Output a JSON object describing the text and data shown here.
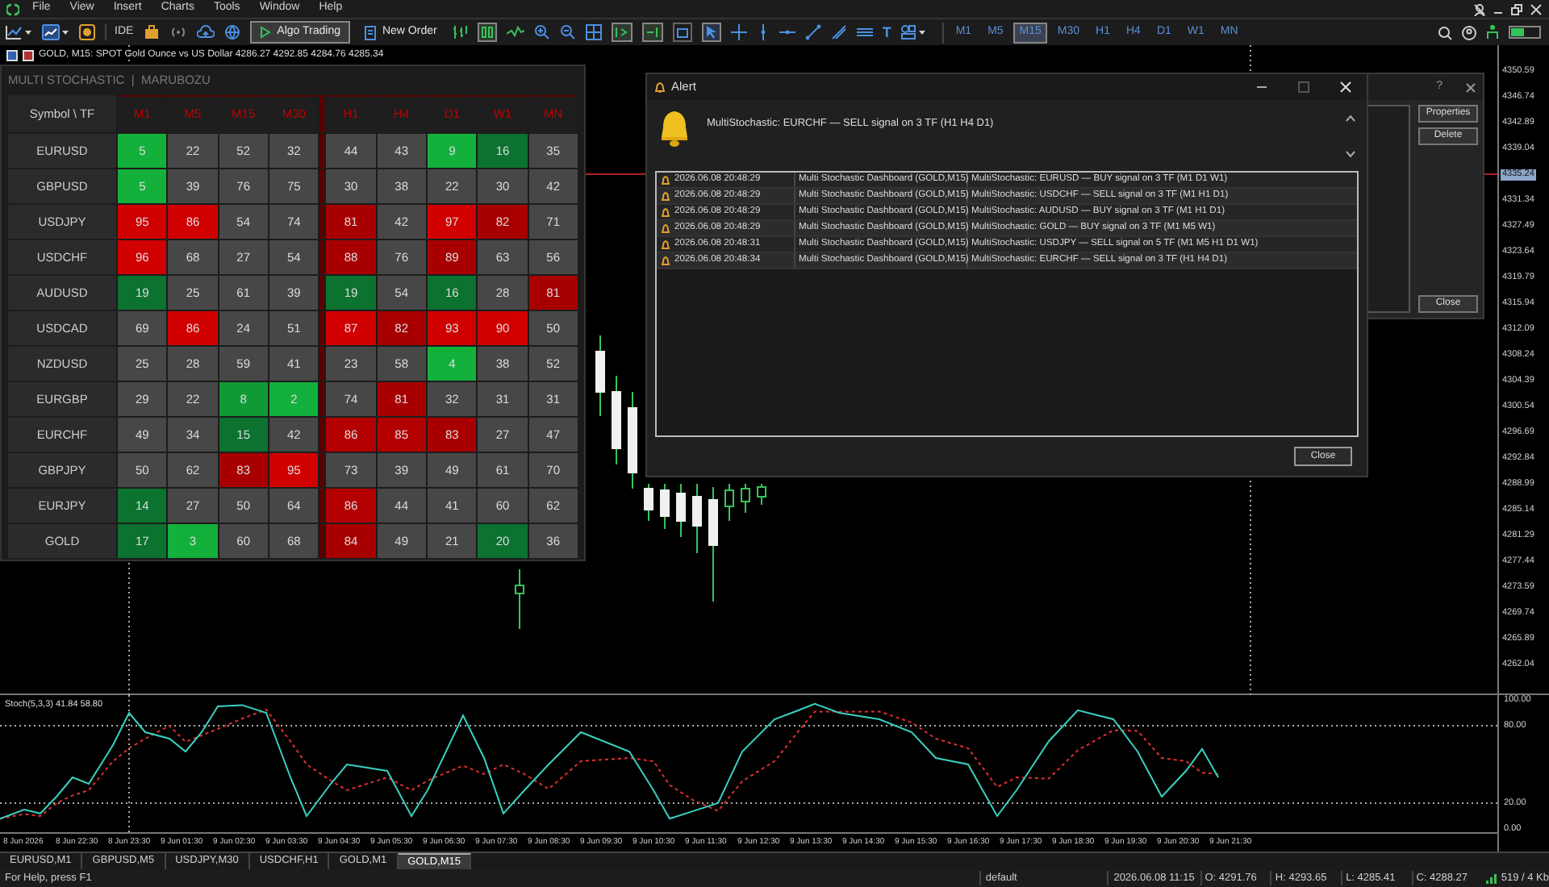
{
  "menu": [
    "File",
    "View",
    "Insert",
    "Charts",
    "Tools",
    "Window",
    "Help"
  ],
  "toolbar": {
    "ide_label": "IDE",
    "algo_trading": {
      "label": "Algo Trading",
      "on": true
    },
    "new_order": "New Order",
    "text_tool": "T",
    "timeframes": [
      {
        "label": "M1",
        "selected": false
      },
      {
        "label": "M5",
        "selected": false
      },
      {
        "label": "M15",
        "selected": true
      },
      {
        "label": "M30",
        "selected": false
      },
      {
        "label": "H1",
        "selected": false
      },
      {
        "label": "H4",
        "selected": false
      },
      {
        "label": "D1",
        "selected": false
      },
      {
        "label": "W1",
        "selected": false
      },
      {
        "label": "MN",
        "selected": false
      }
    ]
  },
  "chart": {
    "title": "GOLD, M15:  SPOT Gold Ounce vs US Dollar  4286.27 4292.85 4284.76 4285.34",
    "price_labels": [
      {
        "label": "4350.59",
        "current": false
      },
      {
        "label": "4346.74",
        "current": false
      },
      {
        "label": "4342.89",
        "current": false
      },
      {
        "label": "4339.04",
        "current": false
      },
      {
        "label": "4335.24",
        "current": true
      },
      {
        "label": "4331.34",
        "current": false
      },
      {
        "label": "4327.49",
        "current": false
      },
      {
        "label": "4323.64",
        "current": false
      },
      {
        "label": "4319.79",
        "current": false
      },
      {
        "label": "4315.94",
        "current": false
      },
      {
        "label": "4312.09",
        "current": false
      },
      {
        "label": "4308.24",
        "current": false
      },
      {
        "label": "4304.39",
        "current": false
      },
      {
        "label": "4300.54",
        "current": false
      },
      {
        "label": "4296.69",
        "current": false
      },
      {
        "label": "4292.84",
        "current": false
      },
      {
        "label": "4288.99",
        "current": false
      },
      {
        "label": "4285.14",
        "current": false
      },
      {
        "label": "4281.29",
        "current": false
      },
      {
        "label": "4277.44",
        "current": false
      },
      {
        "label": "4273.59",
        "current": false
      },
      {
        "label": "4269.74",
        "current": false
      },
      {
        "label": "4265.89",
        "current": false
      },
      {
        "label": "4262.04",
        "current": false
      }
    ],
    "time_labels": [
      "8 Jun 2026",
      "8 Jun 22:30",
      "8 Jun 23:30",
      "9 Jun 01:30",
      "9 Jun 02:30",
      "9 Jun 03:30",
      "9 Jun 04:30",
      "9 Jun 05:30",
      "9 Jun 06:30",
      "9 Jun 07:30",
      "9 Jun 08:30",
      "9 Jun 09:30",
      "9 Jun 10:30",
      "9 Jun 11:30",
      "9 Jun 12:30",
      "9 Jun 13:30",
      "9 Jun 14:30",
      "9 Jun 15:30",
      "9 Jun 16:30",
      "9 Jun 17:30",
      "9 Jun 18:30",
      "9 Jun 19:30",
      "9 Jun 20:30",
      "9 Jun 21:30"
    ]
  },
  "indicator": {
    "title": "Stoch(5,3,3) 41.84 58.80",
    "scale_labels": [
      "100.00",
      "80.00",
      "20.00",
      "0.00"
    ]
  },
  "dashboard": {
    "title": "MULTI STOCHASTIC  |  MARUBOZU",
    "corner": "Symbol \\ TF",
    "columns": [
      "M1",
      "M5",
      "M15",
      "M30",
      "H1",
      "H4",
      "D1",
      "W1",
      "MN"
    ],
    "rows": [
      {
        "symbol": "EURUSD",
        "cells": [
          {
            "value": "5",
            "color": "#14b03c"
          },
          {
            "value": "22",
            "color": "#474747"
          },
          {
            "value": "52",
            "color": "#474747"
          },
          {
            "value": "32",
            "color": "#474747"
          },
          {
            "value": "44",
            "color": "#474747"
          },
          {
            "value": "43",
            "color": "#474747"
          },
          {
            "value": "9",
            "color": "#14b03c"
          },
          {
            "value": "16",
            "color": "#0b7230"
          },
          {
            "value": "35",
            "color": "#474747"
          }
        ]
      },
      {
        "symbol": "GBPUSD",
        "cells": [
          {
            "value": "5",
            "color": "#14b03c"
          },
          {
            "value": "39",
            "color": "#474747"
          },
          {
            "value": "76",
            "color": "#474747"
          },
          {
            "value": "75",
            "color": "#474747"
          },
          {
            "value": "30",
            "color": "#474747"
          },
          {
            "value": "38",
            "color": "#474747"
          },
          {
            "value": "22",
            "color": "#474747"
          },
          {
            "value": "30",
            "color": "#474747"
          },
          {
            "value": "42",
            "color": "#474747"
          }
        ]
      },
      {
        "symbol": "USDJPY",
        "cells": [
          {
            "value": "95",
            "color": "#d10000"
          },
          {
            "value": "86",
            "color": "#d10000"
          },
          {
            "value": "54",
            "color": "#474747"
          },
          {
            "value": "74",
            "color": "#474747"
          },
          {
            "value": "81",
            "color": "#a80000"
          },
          {
            "value": "42",
            "color": "#474747"
          },
          {
            "value": "97",
            "color": "#d10000"
          },
          {
            "value": "82",
            "color": "#a80000"
          },
          {
            "value": "71",
            "color": "#474747"
          }
        ]
      },
      {
        "symbol": "USDCHF",
        "cells": [
          {
            "value": "96",
            "color": "#d10000"
          },
          {
            "value": "68",
            "color": "#474747"
          },
          {
            "value": "27",
            "color": "#474747"
          },
          {
            "value": "54",
            "color": "#474747"
          },
          {
            "value": "88",
            "color": "#a80000"
          },
          {
            "value": "76",
            "color": "#474747"
          },
          {
            "value": "89",
            "color": "#a80000"
          },
          {
            "value": "63",
            "color": "#474747"
          },
          {
            "value": "56",
            "color": "#474747"
          }
        ]
      },
      {
        "symbol": "AUDUSD",
        "cells": [
          {
            "value": "19",
            "color": "#0b7230"
          },
          {
            "value": "25",
            "color": "#474747"
          },
          {
            "value": "61",
            "color": "#474747"
          },
          {
            "value": "39",
            "color": "#474747"
          },
          {
            "value": "19",
            "color": "#0b7230"
          },
          {
            "value": "54",
            "color": "#474747"
          },
          {
            "value": "16",
            "color": "#0b7230"
          },
          {
            "value": "28",
            "color": "#474747"
          },
          {
            "value": "81",
            "color": "#a80000"
          }
        ]
      },
      {
        "symbol": "USDCAD",
        "cells": [
          {
            "value": "69",
            "color": "#474747"
          },
          {
            "value": "86",
            "color": "#d10000"
          },
          {
            "value": "24",
            "color": "#474747"
          },
          {
            "value": "51",
            "color": "#474747"
          },
          {
            "value": "87",
            "color": "#d10000"
          },
          {
            "value": "82",
            "color": "#a80000"
          },
          {
            "value": "93",
            "color": "#d10000"
          },
          {
            "value": "90",
            "color": "#d10000"
          },
          {
            "value": "50",
            "color": "#474747"
          }
        ]
      },
      {
        "symbol": "NZDUSD",
        "cells": [
          {
            "value": "25",
            "color": "#474747"
          },
          {
            "value": "28",
            "color": "#474747"
          },
          {
            "value": "59",
            "color": "#474747"
          },
          {
            "value": "41",
            "color": "#474747"
          },
          {
            "value": "23",
            "color": "#474747"
          },
          {
            "value": "58",
            "color": "#474747"
          },
          {
            "value": "4",
            "color": "#14b03c"
          },
          {
            "value": "38",
            "color": "#474747"
          },
          {
            "value": "52",
            "color": "#474747"
          }
        ]
      },
      {
        "symbol": "EURGBP",
        "cells": [
          {
            "value": "29",
            "color": "#474747"
          },
          {
            "value": "22",
            "color": "#474747"
          },
          {
            "value": "8",
            "color": "#109a36"
          },
          {
            "value": "2",
            "color": "#14b03c"
          },
          {
            "value": "74",
            "color": "#474747"
          },
          {
            "value": "81",
            "color": "#a80000"
          },
          {
            "value": "32",
            "color": "#474747"
          },
          {
            "value": "31",
            "color": "#474747"
          },
          {
            "value": "31",
            "color": "#474747"
          }
        ]
      },
      {
        "symbol": "EURCHF",
        "cells": [
          {
            "value": "49",
            "color": "#474747"
          },
          {
            "value": "34",
            "color": "#474747"
          },
          {
            "value": "15",
            "color": "#0b7230"
          },
          {
            "value": "42",
            "color": "#474747"
          },
          {
            "value": "86",
            "color": "#b30000"
          },
          {
            "value": "85",
            "color": "#b30000"
          },
          {
            "value": "83",
            "color": "#a80000"
          },
          {
            "value": "27",
            "color": "#474747"
          },
          {
            "value": "47",
            "color": "#474747"
          }
        ]
      },
      {
        "symbol": "GBPJPY",
        "cells": [
          {
            "value": "50",
            "color": "#474747"
          },
          {
            "value": "62",
            "color": "#474747"
          },
          {
            "value": "83",
            "color": "#a80000"
          },
          {
            "value": "95",
            "color": "#d10000"
          },
          {
            "value": "73",
            "color": "#474747"
          },
          {
            "value": "39",
            "color": "#474747"
          },
          {
            "value": "49",
            "color": "#474747"
          },
          {
            "value": "61",
            "color": "#474747"
          },
          {
            "value": "70",
            "color": "#474747"
          }
        ]
      },
      {
        "symbol": "EURJPY",
        "cells": [
          {
            "value": "14",
            "color": "#0b7230"
          },
          {
            "value": "27",
            "color": "#474747"
          },
          {
            "value": "50",
            "color": "#474747"
          },
          {
            "value": "64",
            "color": "#474747"
          },
          {
            "value": "86",
            "color": "#b30000"
          },
          {
            "value": "44",
            "color": "#474747"
          },
          {
            "value": "41",
            "color": "#474747"
          },
          {
            "value": "60",
            "color": "#474747"
          },
          {
            "value": "62",
            "color": "#474747"
          }
        ]
      },
      {
        "symbol": "GOLD",
        "cells": [
          {
            "value": "17",
            "color": "#0b7230"
          },
          {
            "value": "3",
            "color": "#14b03c"
          },
          {
            "value": "60",
            "color": "#474747"
          },
          {
            "value": "68",
            "color": "#474747"
          },
          {
            "value": "84",
            "color": "#a80000"
          },
          {
            "value": "49",
            "color": "#474747"
          },
          {
            "value": "21",
            "color": "#474747"
          },
          {
            "value": "20",
            "color": "#0b7230"
          },
          {
            "value": "36",
            "color": "#474747"
          }
        ]
      }
    ]
  },
  "alerts_dialog": {
    "help": "?",
    "buttons": [
      "Properties",
      "Delete",
      "Close"
    ]
  },
  "alert": {
    "title": "Alert",
    "message": "MultiStochastic: EURCHF — SELL signal on 3 TF (H1 H4 D1)",
    "close": "Close",
    "rows": [
      {
        "time": "2026.06.08 20:48:29",
        "source": "Multi Stochastic Dashboard (GOLD,M15)",
        "message": "MultiStochastic: EURUSD — BUY signal on 3 TF (M1 D1 W1)"
      },
      {
        "time": "2026.06.08 20:48:29",
        "source": "Multi Stochastic Dashboard (GOLD,M15)",
        "message": "MultiStochastic: USDCHF — SELL signal on 3 TF (M1 H1 D1)"
      },
      {
        "time": "2026.06.08 20:48:29",
        "source": "Multi Stochastic Dashboard (GOLD,M15)",
        "message": "MultiStochastic: AUDUSD — BUY signal on 3 TF (M1 H1 D1)"
      },
      {
        "time": "2026.06.08 20:48:29",
        "source": "Multi Stochastic Dashboard (GOLD,M15)",
        "message": "MultiStochastic: GOLD — BUY signal on 3 TF (M1 M5 W1)"
      },
      {
        "time": "2026.06.08 20:48:31",
        "source": "Multi Stochastic Dashboard (GOLD,M15)",
        "message": "MultiStochastic: USDJPY — SELL signal on 5 TF (M1 M5 H1 D1 W1)"
      },
      {
        "time": "2026.06.08 20:48:34",
        "source": "Multi Stochastic Dashboard (GOLD,M15)",
        "message": "MultiStochastic: EURCHF — SELL signal on 3 TF (H1 H4 D1)"
      }
    ]
  },
  "chart_tabs": [
    {
      "label": "EURUSD,M1",
      "selected": false
    },
    {
      "label": "GBPUSD,M5",
      "selected": false
    },
    {
      "label": "USDJPY,M30",
      "selected": false
    },
    {
      "label": "USDCHF,H1",
      "selected": false
    },
    {
      "label": "GOLD,M1",
      "selected": false
    },
    {
      "label": "GOLD,M15",
      "selected": true
    }
  ],
  "status_bar": {
    "help": "For Help, press F1",
    "profile": "default",
    "time": "2026.06.08 11:15",
    "open": "O: 4291.76",
    "high": "H: 4293.65",
    "low": "L: 4285.41",
    "close": "C: 4288.27",
    "traffic": "519 / 4 Kb"
  }
}
